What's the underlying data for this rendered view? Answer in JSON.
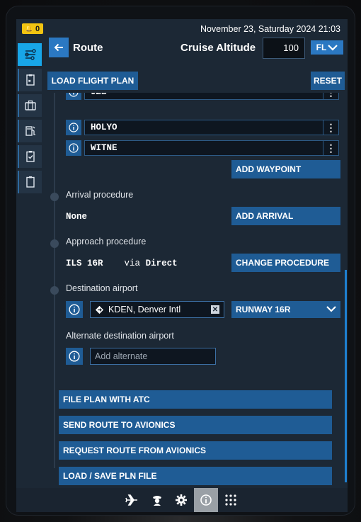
{
  "status": {
    "notification_count": "0",
    "datetime": "November 23, Saturday 2024 21:03"
  },
  "sidebar": {
    "items": [
      {
        "icon": "route-icon",
        "active": true
      },
      {
        "icon": "checklist-icon",
        "active": false
      },
      {
        "icon": "briefcase-icon",
        "active": false
      },
      {
        "icon": "fuel-icon",
        "active": false
      },
      {
        "icon": "clipboard-check-icon",
        "active": false
      },
      {
        "icon": "clipboard-icon",
        "active": false
      }
    ]
  },
  "header": {
    "title": "Route",
    "cruise_label": "Cruise Altitude",
    "cruise_value": "100",
    "unit": "FL"
  },
  "actions": {
    "load_flight_plan": "LOAD FLIGHT PLAN",
    "reset": "RESET"
  },
  "waypoints": [
    {
      "id": "UZB"
    },
    {
      "id": "HOLYO"
    },
    {
      "id": "WITNE"
    }
  ],
  "add_waypoint": "ADD WAYPOINT",
  "arrival": {
    "label": "Arrival procedure",
    "value": "None",
    "button": "ADD ARRIVAL"
  },
  "approach": {
    "label": "Approach procedure",
    "value": "ILS 16R",
    "via": "via",
    "via_value": "Direct",
    "button": "CHANGE PROCEDURE"
  },
  "destination": {
    "label": "Destination airport",
    "value": "KDEN, Denver Intl",
    "runway": "RUNWAY 16R"
  },
  "alternate": {
    "label": "Alternate destination airport",
    "placeholder": "Add alternate"
  },
  "bottom_actions": {
    "file_plan": "FILE PLAN WITH ATC",
    "send_route": "SEND ROUTE TO AVIONICS",
    "request_route": "REQUEST ROUTE FROM AVIONICS",
    "load_save": "LOAD / SAVE PLN FILE"
  },
  "footer": {
    "icons": [
      "airplane-icon",
      "pilot-icon",
      "settings-icon",
      "info-icon",
      "apps-grid-icon"
    ],
    "active": "info-icon"
  },
  "colors": {
    "accent": "#1f5c95",
    "active_tab": "#18a6e8",
    "notification": "#f2c411",
    "panel": "#1c2835"
  }
}
